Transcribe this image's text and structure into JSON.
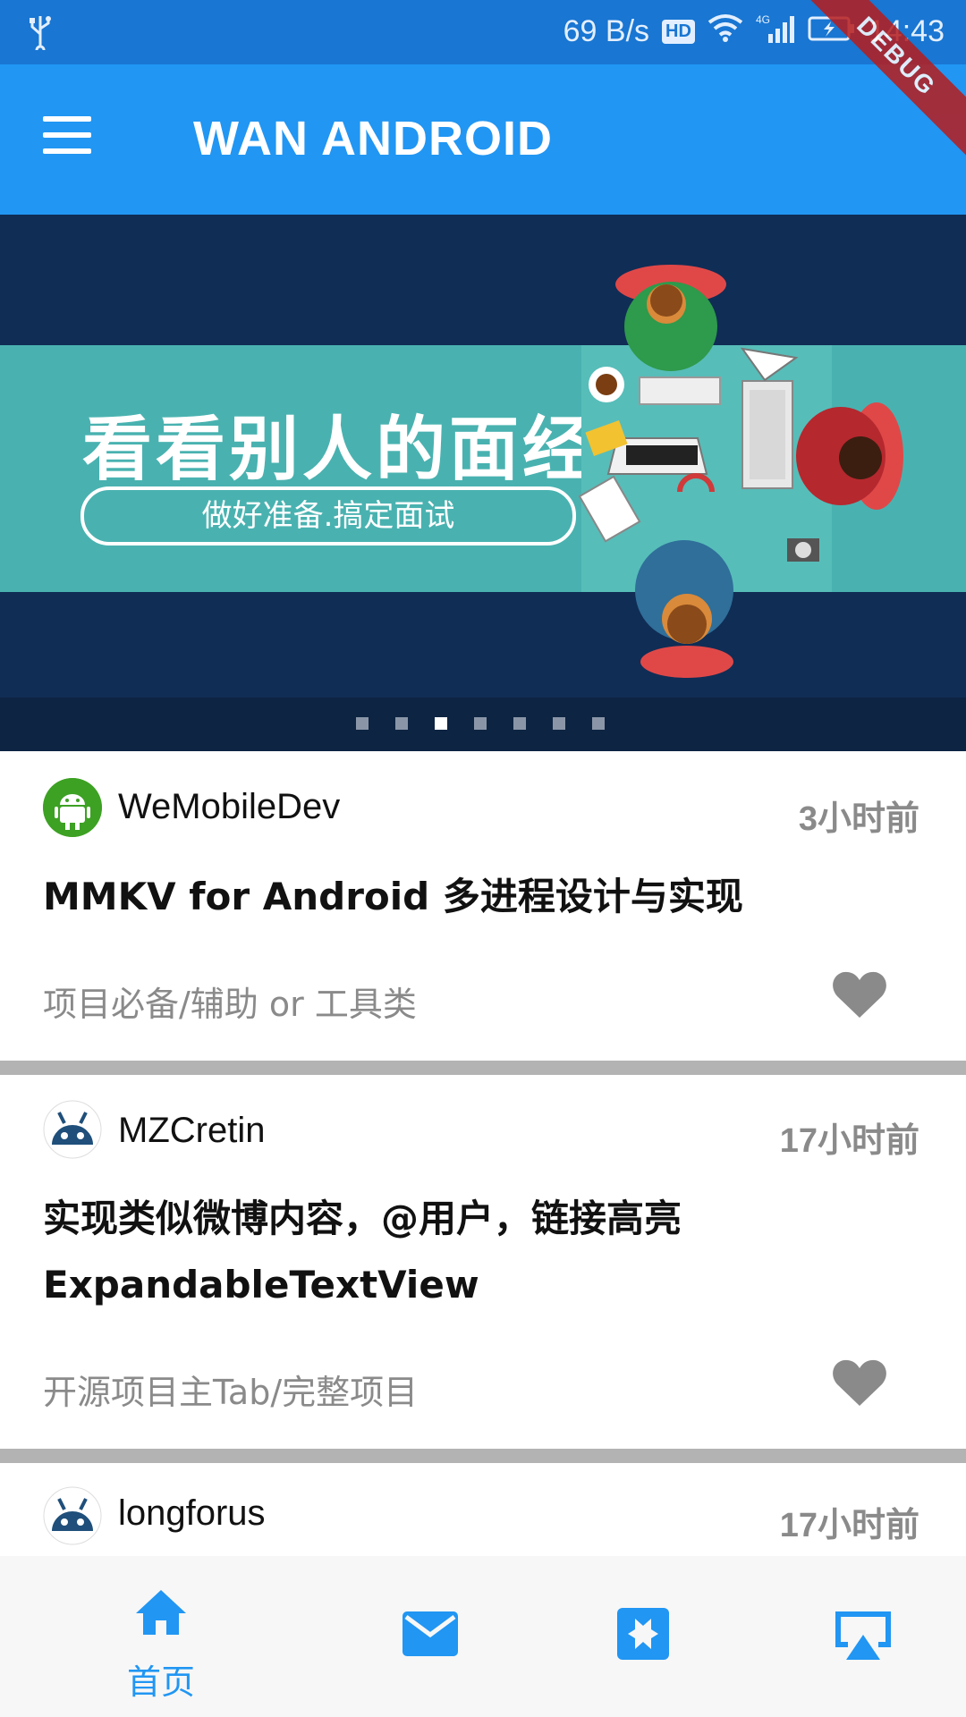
{
  "status_bar": {
    "speed": "69 B/s",
    "hd": "HD",
    "network": "4G",
    "time": "14:43"
  },
  "debug_banner": "DEBUG",
  "app_bar": {
    "title": "WAN ANDROID"
  },
  "banner": {
    "headline": "看看别人的面经",
    "subtitle": "做好准备.搞定面试",
    "page_count": 7,
    "active_index": 2
  },
  "articles": [
    {
      "author": "WeMobileDev",
      "time": "3小时前",
      "title": "MMKV for Android 多进程设计与实现",
      "category": "项目必备/辅助 or 工具类"
    },
    {
      "author": "MZCretin",
      "time": "17小时前",
      "title": "实现类似微博内容，@用户，链接高亮ExpandableTextView",
      "category": "开源项目主Tab/完整项目"
    },
    {
      "author": "longforus",
      "time": "17小时前"
    }
  ],
  "bottom_nav": {
    "home_label": "首页"
  },
  "colors": {
    "primary": "#2196F3",
    "status_bar": "#1976D2",
    "divider": "#b3b3b3"
  }
}
